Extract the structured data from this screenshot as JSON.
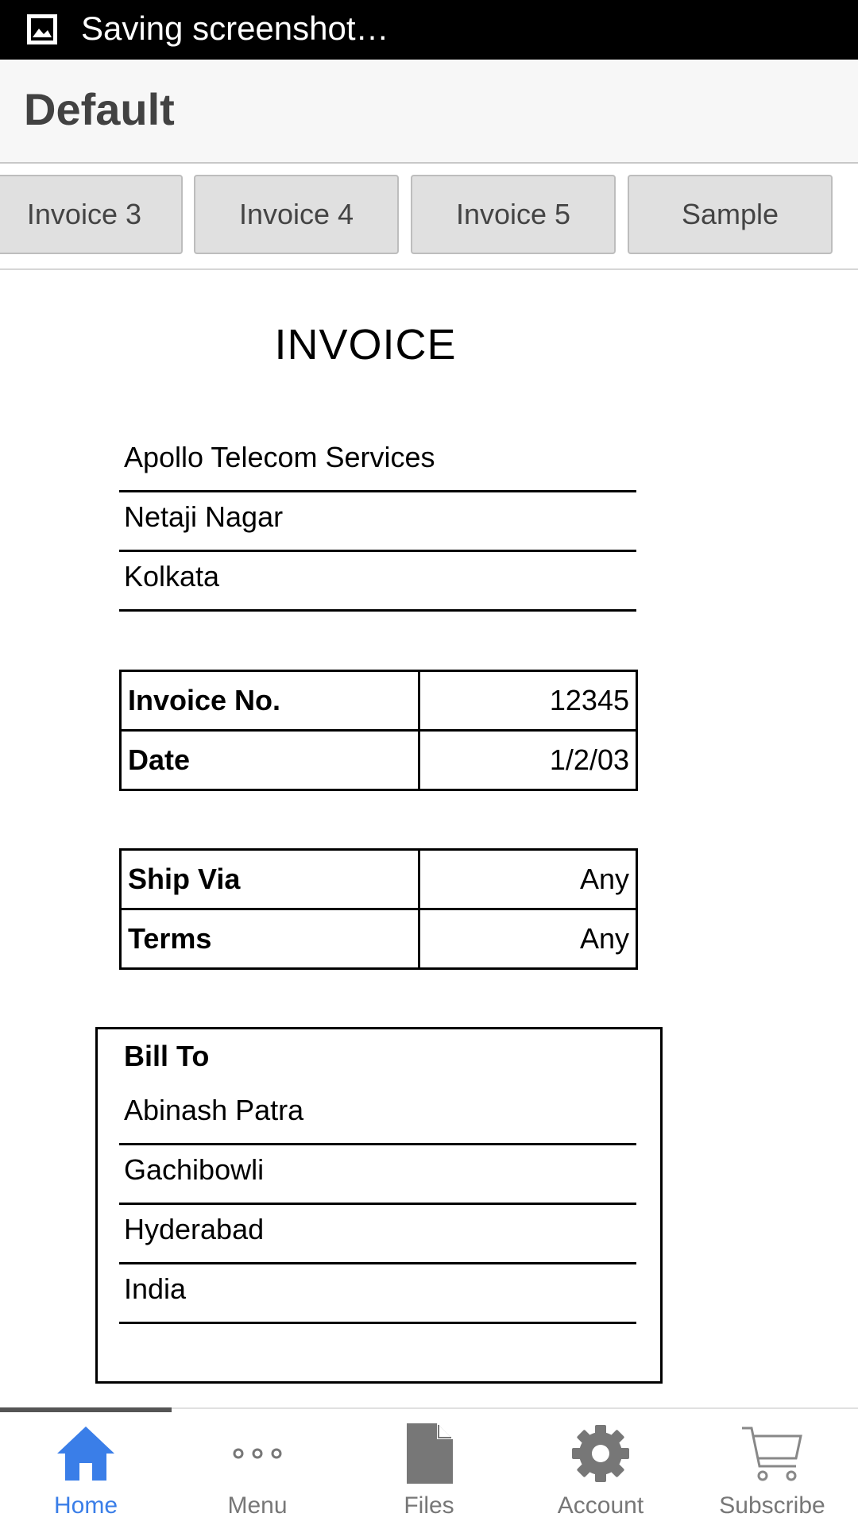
{
  "status_bar": {
    "text": "Saving screenshot…",
    "icon": "image-icon"
  },
  "app_bar": {
    "title": "Default"
  },
  "tabs": [
    {
      "label": "Invoice 3"
    },
    {
      "label": "Invoice 4"
    },
    {
      "label": "Invoice 5"
    },
    {
      "label": "Sample"
    }
  ],
  "invoice": {
    "title": "INVOICE",
    "from": {
      "name": "Apollo Telecom Services",
      "street": "Netaji Nagar",
      "city": "Kolkata"
    },
    "details": [
      {
        "label": "Invoice No.",
        "value": "12345"
      },
      {
        "label": "Date",
        "value": "1/2/03"
      }
    ],
    "shipping": [
      {
        "label": "Ship Via",
        "value": "Any"
      },
      {
        "label": "Terms",
        "value": "Any"
      }
    ],
    "bill_to": {
      "title": "Bill To",
      "lines": [
        "Abinash Patra",
        "Gachibowli",
        "Hyderabad",
        "India"
      ]
    }
  },
  "bottom_nav": {
    "active_color": "#3a7ee8",
    "items": [
      {
        "label": "Home",
        "icon": "home-icon",
        "active": true
      },
      {
        "label": "Menu",
        "icon": "more-horizontal-icon"
      },
      {
        "label": "Files",
        "icon": "file-icon"
      },
      {
        "label": "Account",
        "icon": "gear-icon"
      },
      {
        "label": "Subscribe",
        "icon": "cart-icon"
      }
    ]
  }
}
